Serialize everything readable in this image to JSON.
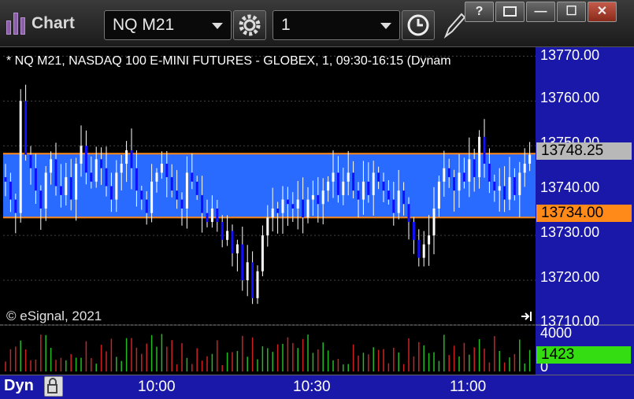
{
  "window": {
    "title": "Chart",
    "symbol": "NQ M21",
    "interval": "1",
    "buttons": {
      "help": "?",
      "minimize": "—",
      "maximize": "☐",
      "close": "✕"
    }
  },
  "chart": {
    "header": "* NQ M21, NASDAQ 100 E-MINI FUTURES - GLOBEX, 1, 09:30-16:15 (Dynam",
    "copyright": "© eSignal, 2021",
    "price_ticks": [
      "13770.00",
      "13760.00",
      "13750.00",
      "13740.00",
      "13730.00",
      "13720.00",
      "13710.00"
    ],
    "volume_ticks": [
      "4000",
      "0"
    ],
    "time_ticks": [
      "10:00",
      "10:30",
      "11:00"
    ],
    "upper_line_label": "13748.25",
    "lower_line_label": "13734.00",
    "volume_label": "1423",
    "bottom_label": "Dyn"
  },
  "colors": {
    "band": "#2a6bff",
    "band_line": "#ff8a1a",
    "up": "#ffffff",
    "down": "#1010ff",
    "vol_up": "#22bb22",
    "vol_down": "#cc2222",
    "upper_tag_bg": "#b8b8b8",
    "lower_tag_bg": "#ff8a1a",
    "vol_tag_bg": "#33dd11"
  },
  "chart_data": {
    "type": "candlestick",
    "ylim": [
      13710,
      13772
    ],
    "bands": [
      {
        "from": 13734.0,
        "to": 13748.25
      }
    ],
    "close_series": [
      13742,
      13738,
      13735,
      13760,
      13748,
      13745,
      13740,
      13736,
      13744,
      13747,
      13741,
      13739,
      13743,
      13738,
      13746,
      13750,
      13744,
      13742,
      13747,
      13745,
      13741,
      13738,
      13744,
      13746,
      13749,
      13745,
      13740,
      13738,
      13735,
      13742,
      13744,
      13746,
      13743,
      13740,
      13738,
      13736,
      13744,
      13742,
      13739,
      13735,
      13733,
      13736,
      13733,
      13729,
      13731,
      13726,
      13728,
      13720,
      13724,
      13716,
      13722,
      13730,
      13734,
      13736,
      13735,
      13738,
      13737,
      13736,
      13738,
      13734,
      13738,
      13739,
      13737,
      13740,
      13742,
      13744,
      13739,
      13742,
      13744,
      13740,
      13738,
      13742,
      13739,
      13744,
      13742,
      13740,
      13738,
      13735,
      13740,
      13737,
      13733,
      13729,
      13725,
      13728,
      13730,
      13736,
      13742,
      13745,
      13743,
      13740,
      13744,
      13742,
      13747,
      13743,
      13752,
      13746,
      13742,
      13740,
      13741,
      13738,
      13743,
      13739,
      13744,
      13746,
      13748
    ],
    "volume_scale_max": 4000,
    "last_volume": 1423
  }
}
